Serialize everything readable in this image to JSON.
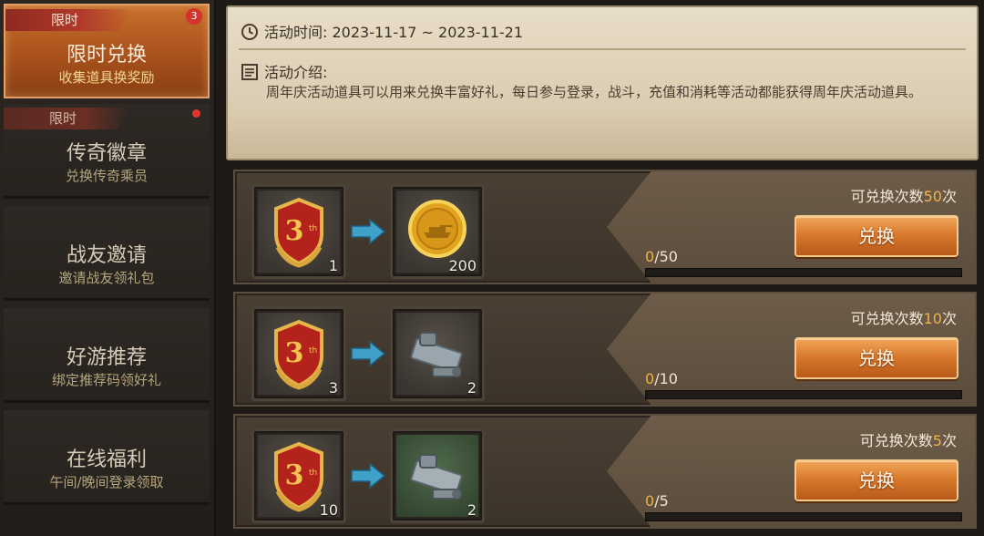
{
  "sidebar": {
    "items": [
      {
        "tag": "限时",
        "title": "限时兑换",
        "subtitle": "收集道具换奖励",
        "badge": "3"
      },
      {
        "tag": "限时",
        "title": "传奇徽章",
        "subtitle": "兑换传奇乘员"
      },
      {
        "title": "战友邀请",
        "subtitle": "邀请战友领礼包"
      },
      {
        "title": "好游推荐",
        "subtitle": "绑定推荐码领好礼"
      },
      {
        "title": "在线福利",
        "subtitle": "午间/晚间登录领取"
      }
    ]
  },
  "info": {
    "time_label": "活动时间: ",
    "time_value": "2023-11-17 ~ 2023-11-21",
    "intro_label": "活动介绍:",
    "intro_text": "周年庆活动道具可以用来兑换丰富好礼，每日参与登录，战斗，充值和消耗等活动都能获得周年庆活动道具。"
  },
  "exchanges": [
    {
      "cost_qty": "1",
      "reward_qty": "200",
      "reward_icon": "gold-coin-icon",
      "limit_prefix": "可兑换次数",
      "limit_num": "50",
      "limit_suffix": "次",
      "button": "兑换",
      "progress_current": "0",
      "progress_total": "/50",
      "progress": 0
    },
    {
      "cost_qty": "3",
      "reward_qty": "2",
      "reward_icon": "tank-part-icon",
      "limit_prefix": "可兑换次数",
      "limit_num": "10",
      "limit_suffix": "次",
      "button": "兑换",
      "progress_current": "0",
      "progress_total": "/10",
      "progress": 0
    },
    {
      "cost_qty": "10",
      "reward_qty": "2",
      "reward_icon": "tank-part-green-icon",
      "limit_prefix": "可兑换次数",
      "limit_num": "5",
      "limit_suffix": "次",
      "button": "兑换",
      "progress_current": "0",
      "progress_total": "/5",
      "progress": 0
    }
  ],
  "colors": {
    "accent": "#d97a2d",
    "highlight": "#f0b24a",
    "badge": "#d3332a"
  }
}
